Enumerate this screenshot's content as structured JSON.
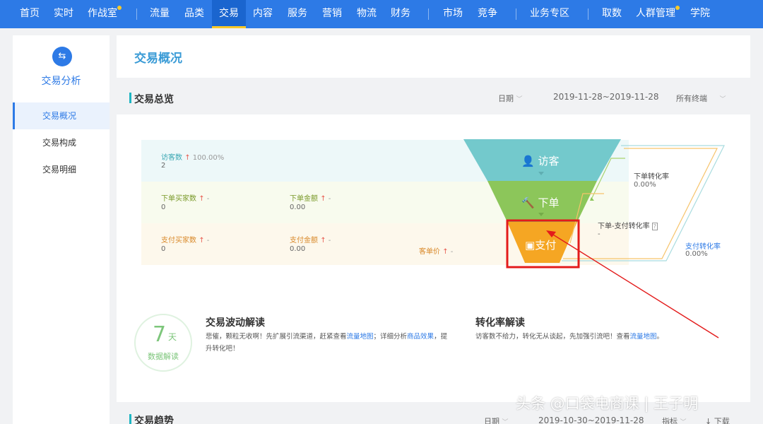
{
  "topnav": {
    "items": [
      "首页",
      "实时",
      "作战室",
      "流量",
      "品类",
      "交易",
      "内容",
      "服务",
      "营销",
      "物流",
      "财务",
      "市场",
      "竞争",
      "业务专区",
      "取数",
      "人群管理",
      "学院"
    ],
    "active": "交易",
    "accent": "#2d7ae6"
  },
  "sidebar": {
    "title": "交易分析",
    "items": [
      "交易概况",
      "交易构成",
      "交易明细"
    ]
  },
  "header": {
    "title": "交易概况"
  },
  "overview": {
    "title": "交易总览",
    "date_label": "日期",
    "date_range": "2019-11-28~2019-11-28",
    "terminal": "所有终端"
  },
  "metrics": {
    "visitors": {
      "label": "访客数",
      "change": "100.00%",
      "value": "2"
    },
    "order_buyers": {
      "label": "下单买家数",
      "change": "-",
      "value": "0"
    },
    "order_amount": {
      "label": "下单金额",
      "change": "-",
      "value": "0.00"
    },
    "pay_buyers": {
      "label": "支付买家数",
      "change": "-",
      "value": "0"
    },
    "pay_amount": {
      "label": "支付金额",
      "change": "-",
      "value": "0.00"
    },
    "unit_price": {
      "label": "客单价",
      "change": "-"
    }
  },
  "funnel": {
    "stages": [
      "访客",
      "下单",
      "支付"
    ],
    "colors": [
      "#73c9cc",
      "#8cc65a",
      "#f5a623"
    ],
    "rates": {
      "order_conv": {
        "label": "下单转化率",
        "value": "0.00%"
      },
      "order_pay_conv": {
        "label": "下单-支付转化率",
        "value": "-"
      },
      "pay_conv": {
        "label": "支付转化率",
        "value": "0.00%"
      }
    }
  },
  "insight": {
    "badge_num": "7",
    "badge_unit": "天",
    "badge_label": "数据解读",
    "wave": {
      "title": "交易波动解读",
      "t1": "悲催，颗粒无收啊！先扩展引流渠道，赶紧查看",
      "l1": "流量地图",
      "t2": "；详细分析",
      "l2": "商品效果",
      "t3": "，提升转化吧！"
    },
    "conv": {
      "title": "转化率解读",
      "t1": "访客数不给力，转化无从谈起，先加强引流吧！查看",
      "l1": "流量地图",
      "t2": "。"
    }
  },
  "trend": {
    "title": "交易趋势",
    "date_label": "日期",
    "date_range": "2019-10-30~2019-11-28",
    "metric_label": "指标",
    "download": "下载"
  },
  "watermark": "头条 @口袋电商课 | 王子明"
}
